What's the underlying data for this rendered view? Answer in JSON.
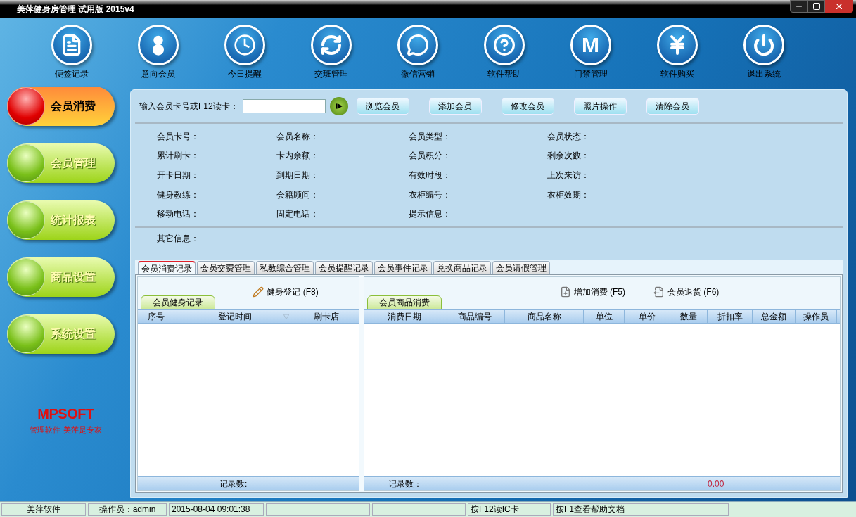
{
  "window": {
    "title": "美萍健身房管理 试用版 2015v4"
  },
  "toolbar": [
    {
      "kind": "note",
      "label": "便签记录"
    },
    {
      "kind": "person",
      "label": "意向会员"
    },
    {
      "kind": "clock",
      "label": "今日提醒"
    },
    {
      "kind": "refresh",
      "label": "交班管理"
    },
    {
      "kind": "chat",
      "label": "微信营销"
    },
    {
      "kind": "help",
      "label": "软件帮助"
    },
    {
      "kind": "letter",
      "glyph": "M",
      "label": "门禁管理"
    },
    {
      "kind": "yen",
      "label": "软件购买"
    },
    {
      "kind": "power",
      "label": "退出系统"
    }
  ],
  "sidebar": {
    "items": [
      {
        "label": "会员消费",
        "selected": true
      },
      {
        "label": "会员管理",
        "selected": false
      },
      {
        "label": "统计报表",
        "selected": false
      },
      {
        "label": "商品设置",
        "selected": false
      },
      {
        "label": "系统设置",
        "selected": false
      }
    ],
    "logo": {
      "text": "MPSOFT",
      "slogan": "管理软件 美萍是专家"
    }
  },
  "search": {
    "label": "输入会员卡号或F12读卡："
  },
  "buttons": [
    "浏览会员",
    "添加会员",
    "修改会员",
    "照片操作",
    "清除会员"
  ],
  "info_columns": [
    [
      "会员卡号：",
      "累计刷卡：",
      "开卡日期：",
      "健身教练：",
      "移动电话："
    ],
    [
      "会员名称：",
      "卡内余额：",
      "到期日期：",
      "会籍顾问：",
      "固定电话："
    ],
    [
      "会员类型：",
      "会员积分：",
      "有效时段：",
      "衣柜编号：",
      "提示信息："
    ],
    [
      "会员状态：",
      "剩余次数：",
      "上次来访：",
      "衣柜效期："
    ]
  ],
  "other_info": "其它信息：",
  "tabs": [
    {
      "label": "会员消费记录",
      "selected": true
    },
    {
      "label": "会员交费管理",
      "selected": false
    },
    {
      "label": "私教综合管理",
      "selected": false
    },
    {
      "label": "会员提醒记录",
      "selected": false
    },
    {
      "label": "会员事件记录",
      "selected": false
    },
    {
      "label": "兑换商品记录",
      "selected": false
    },
    {
      "label": "会员请假管理",
      "selected": false
    }
  ],
  "fitness_panel": {
    "tab": "会员健身记录",
    "actions": [
      {
        "kind": "edit",
        "label": "健身登记 (F8)"
      }
    ],
    "columns": [
      "序号",
      "登记时间",
      "刷卡店"
    ],
    "footer": "记录数:"
  },
  "goods_panel": {
    "tab": "会员商品消费",
    "actions": [
      {
        "kind": "add",
        "label": "增加消费 (F5)"
      },
      {
        "kind": "return",
        "label": "会员退货 (F6)"
      }
    ],
    "columns": [
      "消费日期",
      "商品编号",
      "商品名称",
      "单位",
      "单价",
      "数量",
      "折扣率",
      "总金额",
      "操作员"
    ],
    "footer": "记录数：",
    "total": "0.00"
  },
  "status_bar": [
    "美萍软件",
    "操作员：admin",
    "2015-08-04 09:01:38",
    "按F12读IC卡",
    "按F1查看帮助文档"
  ]
}
